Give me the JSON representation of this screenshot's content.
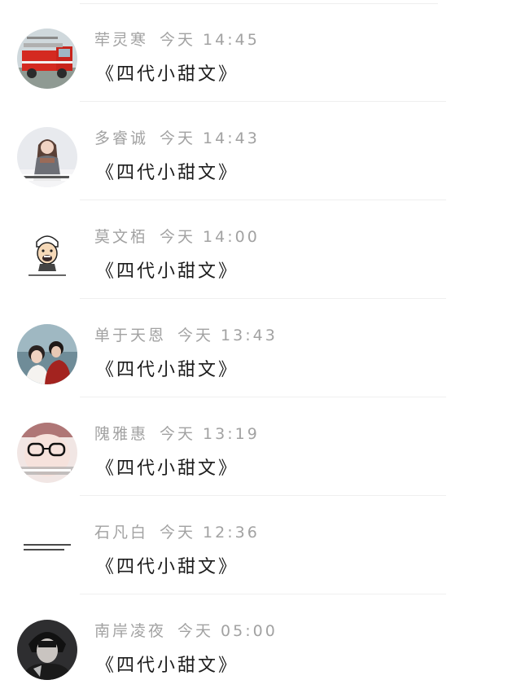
{
  "messages": [
    {
      "name": "荦灵寒",
      "time": "今天 14:45",
      "text": "《四代小甜文》",
      "avatar": "fire-truck-avatar"
    },
    {
      "name": "多睿诚",
      "time": "今天 14:43",
      "text": "《四代小甜文》",
      "avatar": "girl-in-snow-avatar"
    },
    {
      "name": "莫文栢",
      "time": "今天 14:00",
      "text": "《四代小甜文》",
      "avatar": "cartoon-face-avatar"
    },
    {
      "name": "单于天恩",
      "time": "今天 13:43",
      "text": "《四代小甜文》",
      "avatar": "couple-photo-avatar"
    },
    {
      "name": "隗雅惠",
      "time": "今天 13:19",
      "text": "《四代小甜文》",
      "avatar": "glasses-face-avatar"
    },
    {
      "name": "石凡白",
      "time": "今天 12:36",
      "text": "《四代小甜文》",
      "avatar": "text-card-avatar"
    },
    {
      "name": "南岸凌夜",
      "time": "今天 05:00",
      "text": "《四代小甜文》",
      "avatar": "dark-portrait-avatar"
    }
  ],
  "colors": {
    "name_text": "#a2a2a2",
    "message_text": "#1c1c1c",
    "divider": "#efefef"
  }
}
